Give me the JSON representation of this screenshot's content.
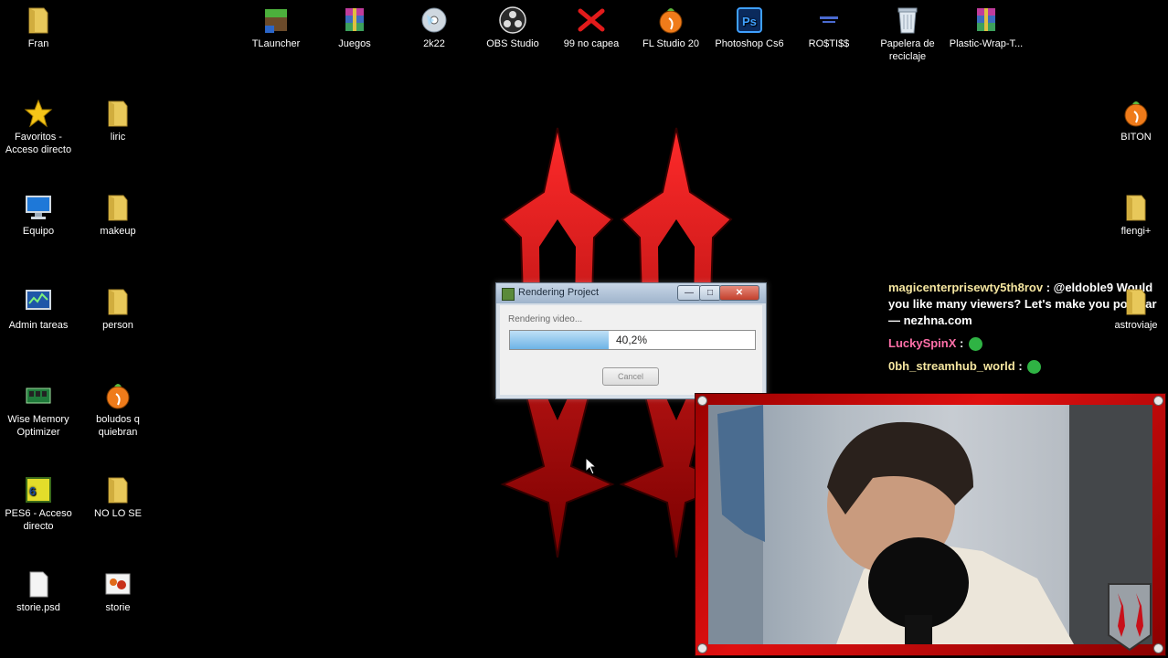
{
  "desktop": {
    "top_row": [
      {
        "label": "Fran",
        "icon": "folder-icon"
      },
      {
        "label": "TLauncher",
        "icon": "tlauncher-icon"
      },
      {
        "label": "Juegos",
        "icon": "winrar-icon"
      },
      {
        "label": "2k22",
        "icon": "cd-icon"
      },
      {
        "label": "OBS Studio",
        "icon": "obs-icon"
      },
      {
        "label": "99 no capea",
        "icon": "red-x-icon"
      },
      {
        "label": "FL Studio 20",
        "icon": "fl-studio-icon"
      },
      {
        "label": "Photoshop Cs6",
        "icon": "photoshop-icon"
      },
      {
        "label": "RO$TI$$",
        "icon": "shortcut-icon"
      },
      {
        "label": "Papelera de reciclaje",
        "icon": "recycle-bin-icon"
      },
      {
        "label": "Plastic-Wrap-T...",
        "icon": "winrar-icon"
      }
    ],
    "left_col1": [
      {
        "label": "Favoritos - Acceso directo",
        "icon": "star-icon"
      },
      {
        "label": "Equipo",
        "icon": "computer-icon"
      },
      {
        "label": "Admin tareas",
        "icon": "task-manager-icon"
      },
      {
        "label": "Wise Memory Optimizer",
        "icon": "memory-icon"
      },
      {
        "label": "PES6 - Acceso directo",
        "icon": "pes6-icon"
      },
      {
        "label": "storie.psd",
        "icon": "file-icon"
      }
    ],
    "left_col2": [
      {
        "label": "liric",
        "icon": "folder-icon"
      },
      {
        "label": "makeup",
        "icon": "folder-icon"
      },
      {
        "label": "person",
        "icon": "folder-icon"
      },
      {
        "label": "boludos q quiebran",
        "icon": "fl-studio-icon"
      },
      {
        "label": "NO LO SE",
        "icon": "folder-icon"
      },
      {
        "label": "storie",
        "icon": "image-icon"
      }
    ],
    "right_col": [
      {
        "label": "BITON",
        "icon": "fl-studio-icon"
      },
      {
        "label": "flengi+",
        "icon": "folder-icon"
      },
      {
        "label": "astroviaje",
        "icon": "folder-icon"
      }
    ]
  },
  "dialog": {
    "title": "Rendering Project",
    "status": "Rendering video...",
    "progress_percent": 40.2,
    "progress_label": "40,2%",
    "cancel_label": "Cancel"
  },
  "chat": [
    {
      "user": "magicenterprisewty5th8rov",
      "text": ": @eldoble9 Would you like many viewers? Let's make you popular — nezhna.com"
    },
    {
      "user": "LuckySpinX",
      "text": ":"
    },
    {
      "user": "0bh_streamhub_world",
      "text": ":"
    }
  ],
  "colors": {
    "logo_red": "#c8101a",
    "progress_fill": "#6db3e6",
    "frame_red": "#e01010"
  }
}
